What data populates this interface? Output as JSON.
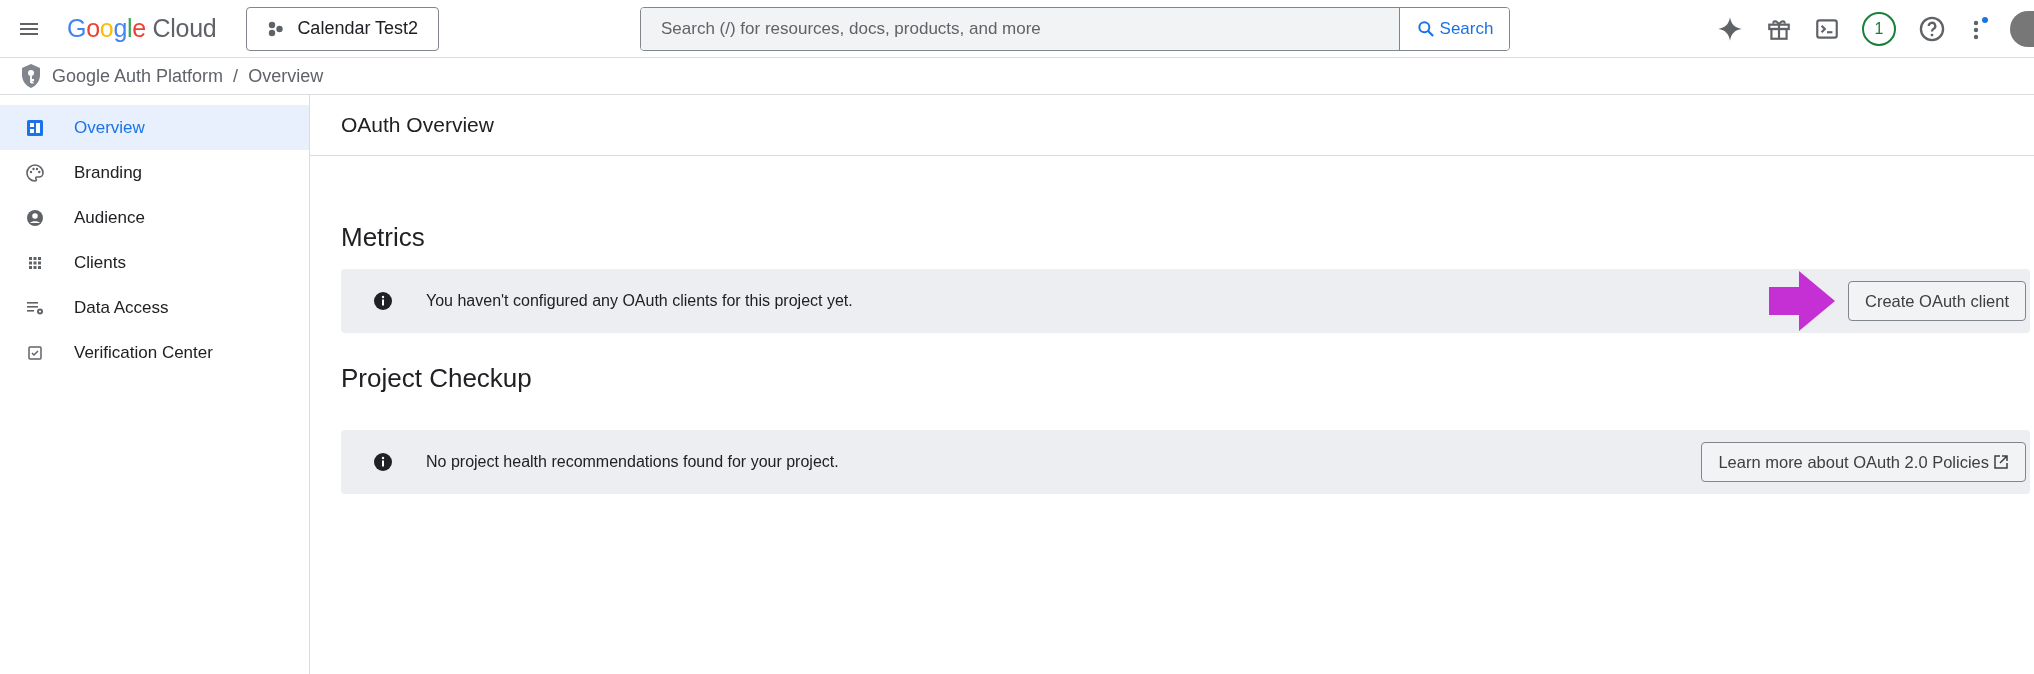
{
  "topbar": {
    "logo": "Google Cloud",
    "project": "Calendar Test2",
    "search": {
      "placeholder": "Search (/) for resources, docs, products, and more",
      "button": "Search"
    },
    "notification_count": "1",
    "has_update_dot": true
  },
  "breadcrumb": {
    "items": [
      "Google Auth Platform",
      "Overview"
    ],
    "separator": "/"
  },
  "sidebar": {
    "items": [
      {
        "label": "Overview",
        "kind": "dashboard",
        "selected": true
      },
      {
        "label": "Branding",
        "kind": "palette",
        "selected": false
      },
      {
        "label": "Audience",
        "kind": "person",
        "selected": false
      },
      {
        "label": "Clients",
        "kind": "grid",
        "selected": false
      },
      {
        "label": "Data Access",
        "kind": "settings",
        "selected": false
      },
      {
        "label": "Verification Center",
        "kind": "checkbox",
        "selected": false
      }
    ]
  },
  "page": {
    "title": "OAuth Overview",
    "sections": [
      {
        "heading": "Metrics",
        "message": "You haven't configured any OAuth clients for this project yet.",
        "button": "Create OAuth client",
        "external_link": false,
        "highlighted": true
      },
      {
        "heading": "Project Checkup",
        "message": "No project health recommendations found for your project.",
        "button": "Learn more about OAuth 2.0 Policies",
        "external_link": true,
        "highlighted": false
      }
    ]
  }
}
